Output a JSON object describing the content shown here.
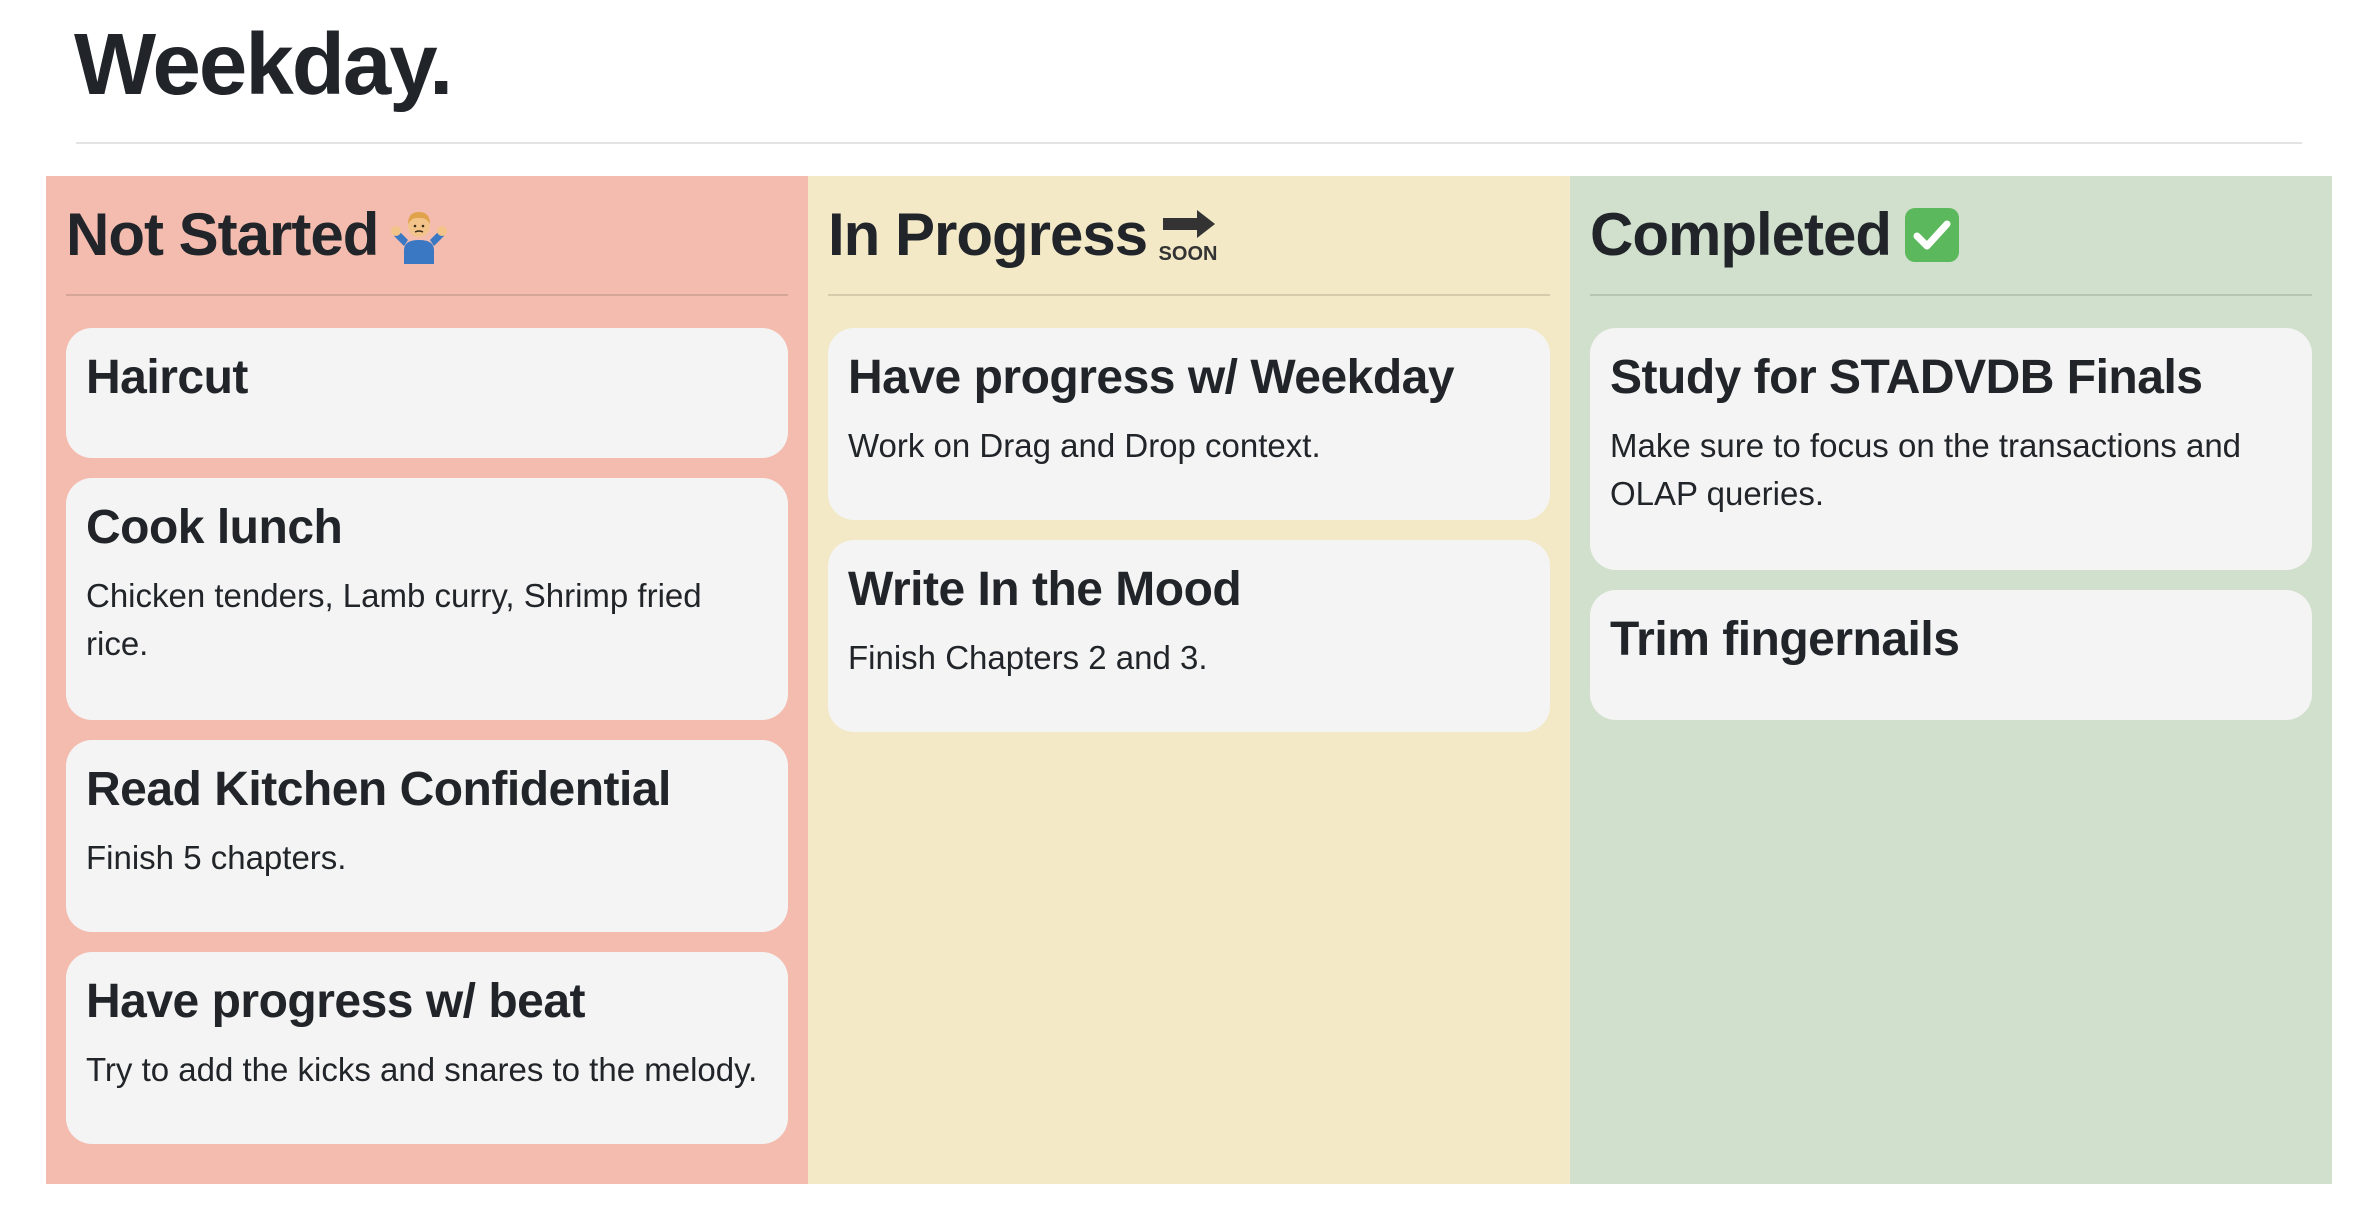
{
  "app": {
    "title": "Weekday."
  },
  "columns": [
    {
      "id": "not-started",
      "title": "Not Started",
      "emoji_icon": "person-shrugging-icon",
      "background": "#f4bcaf",
      "cards": [
        {
          "title": "Haircut",
          "description": ""
        },
        {
          "title": "Cook lunch",
          "description": "Chicken tenders, Lamb curry, Shrimp fried rice."
        },
        {
          "title": "Read Kitchen Confidential",
          "description": "Finish 5 chapters."
        },
        {
          "title": "Have progress w/ beat",
          "description": "Try to add the kicks and snares to the melody."
        }
      ]
    },
    {
      "id": "in-progress",
      "title": "In Progress",
      "emoji_icon": "soon-arrow-icon",
      "emoji_text": "SOON",
      "background": "#f3e9c7",
      "cards": [
        {
          "title": "Have progress w/ Weekday",
          "description": "Work on Drag and Drop context."
        },
        {
          "title": "Write In the Mood",
          "description": "Finish Chapters 2 and 3."
        }
      ]
    },
    {
      "id": "completed",
      "title": "Completed",
      "emoji_icon": "check-mark-button-icon",
      "background": "#d0e0cd",
      "cards": [
        {
          "title": "Study for STADVDB Finals",
          "description": "Make sure to focus on the transactions and OLAP queries."
        },
        {
          "title": "Trim fingernails",
          "description": ""
        }
      ]
    }
  ]
}
